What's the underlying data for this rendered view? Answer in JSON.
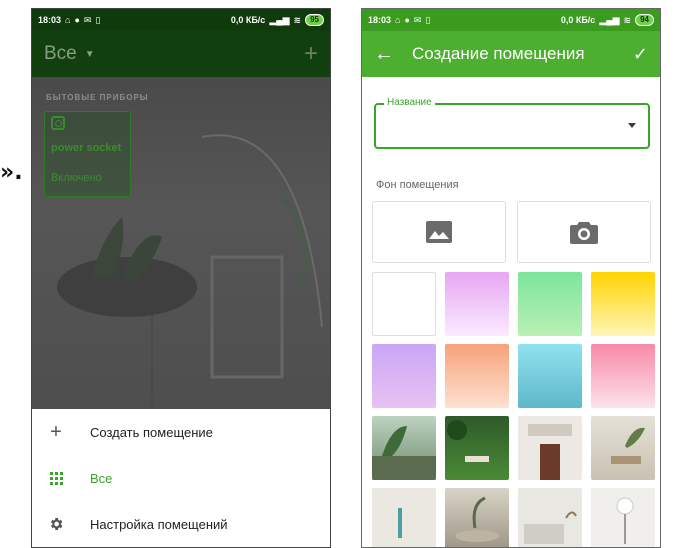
{
  "fragment": "».",
  "left_phone": {
    "status": {
      "time": "18:03",
      "speed": "0,0 КБ/с",
      "battery": "95"
    },
    "appbar": {
      "title": "Все",
      "add_icon": "plus-icon"
    },
    "section_title": "БЫТОВЫЕ ПРИБОРЫ",
    "device": {
      "name": "power socket",
      "status": "Включено"
    },
    "menu": [
      {
        "label": "Создать помещение",
        "icon": "plus-icon"
      },
      {
        "label": "Все",
        "icon": "grid-icon",
        "active": true
      },
      {
        "label": "Настройка помещений",
        "icon": "gear-icon"
      }
    ]
  },
  "right_phone": {
    "status": {
      "time": "18:03",
      "speed": "0,0 КБ/с",
      "battery": "94"
    },
    "appbar": {
      "title": "Создание помещения",
      "back_icon": "arrow-back-icon",
      "confirm_icon": "check-icon"
    },
    "name_field": {
      "label": "Название",
      "value": ""
    },
    "background_label": "Фон помещения",
    "pickers": [
      "image-icon",
      "camera-icon"
    ],
    "colors": {
      "accent": "#4caf30",
      "swatches": [
        "#ffffff",
        "#e7a6f3",
        "#7ee59a",
        "#ffd400",
        "#c9a6f5",
        "#f7a27a",
        "#8fe3ef",
        "#f78aa8"
      ]
    }
  }
}
